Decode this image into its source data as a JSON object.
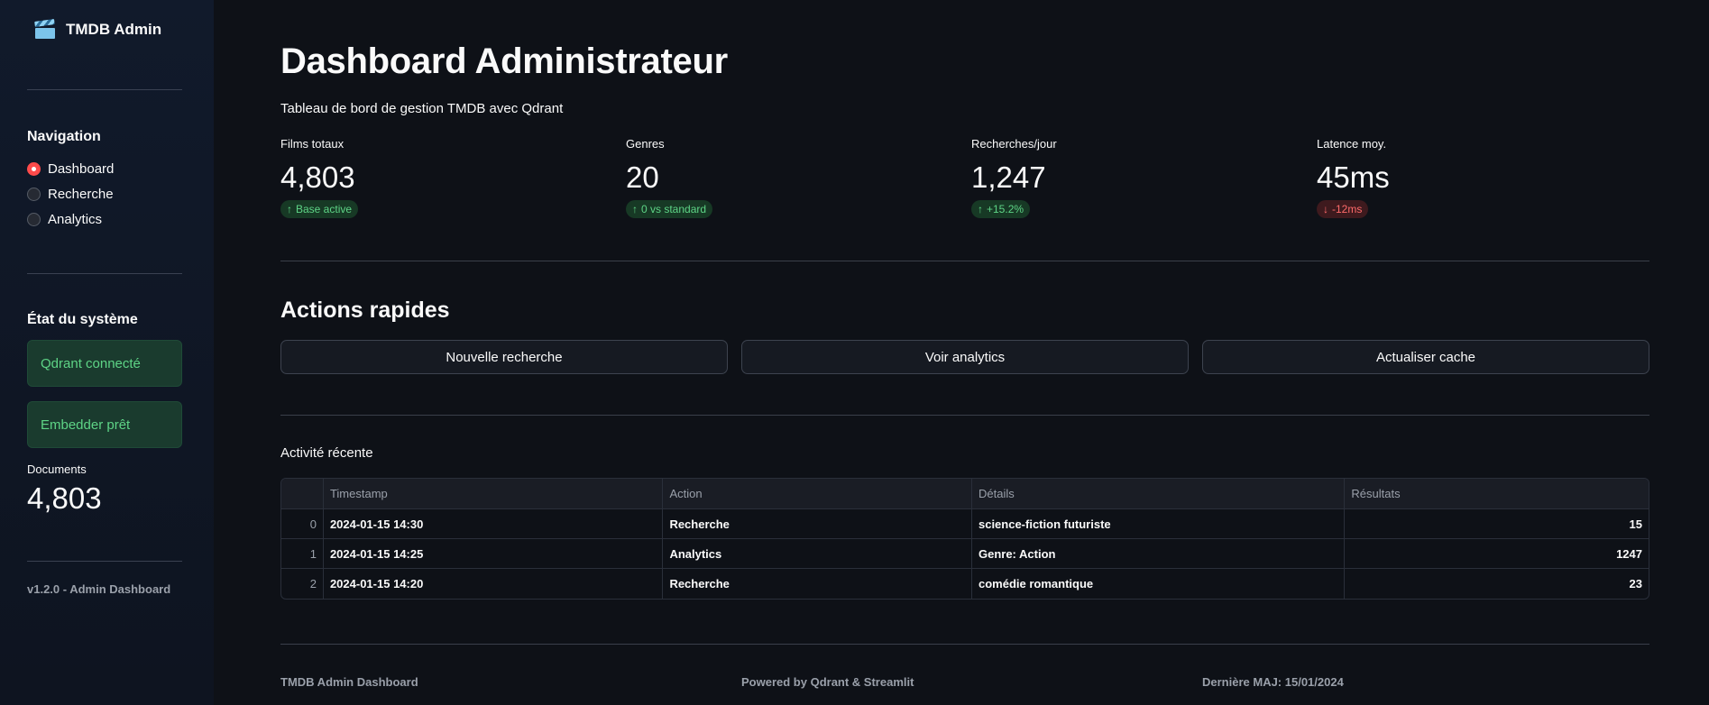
{
  "sidebar": {
    "brand": "TMDB Admin",
    "nav_title": "Navigation",
    "nav_items": [
      {
        "label": "Dashboard",
        "selected": true
      },
      {
        "label": "Recherche",
        "selected": false
      },
      {
        "label": "Analytics",
        "selected": false
      }
    ],
    "system_title": "État du système",
    "status": [
      "Qdrant connecté",
      "Embedder prêt"
    ],
    "documents_label": "Documents",
    "documents_value": "4,803",
    "version": "v1.2.0 - Admin Dashboard"
  },
  "main": {
    "title": "Dashboard Administrateur",
    "subtitle": "Tableau de bord de gestion TMDB avec Qdrant",
    "metrics": [
      {
        "label": "Films totaux",
        "value": "4,803",
        "delta": "Base active",
        "direction": "up"
      },
      {
        "label": "Genres",
        "value": "20",
        "delta": "0 vs standard",
        "direction": "up"
      },
      {
        "label": "Recherches/jour",
        "value": "1,247",
        "delta": "+15.2%",
        "direction": "up"
      },
      {
        "label": "Latence moy.",
        "value": "45ms",
        "delta": "-12ms",
        "direction": "down"
      }
    ],
    "actions_title": "Actions rapides",
    "actions": [
      "Nouvelle recherche",
      "Voir analytics",
      "Actualiser cache"
    ],
    "activity_title": "Activité récente",
    "table": {
      "columns": [
        "",
        "Timestamp",
        "Action",
        "Détails",
        "Résultats"
      ],
      "rows": [
        [
          "0",
          "2024-01-15 14:30",
          "Recherche",
          "science-fiction futuriste",
          "15"
        ],
        [
          "1",
          "2024-01-15 14:25",
          "Analytics",
          "Genre: Action",
          "1247"
        ],
        [
          "2",
          "2024-01-15 14:20",
          "Recherche",
          "comédie romantique",
          "23"
        ]
      ]
    },
    "footer": [
      "TMDB Admin Dashboard",
      "Powered by Qdrant & Streamlit",
      "Dernière MAJ: 15/01/2024"
    ]
  },
  "colors": {
    "background": "#0e1117",
    "sidebar": "#111a2b",
    "accent": "#ff4b4b",
    "success": "#5ed486",
    "danger": "#ff6b6b"
  },
  "icons": {
    "brand": "clapperboard-icon",
    "delta_up": "arrow-up-icon",
    "delta_down": "arrow-down-icon"
  }
}
